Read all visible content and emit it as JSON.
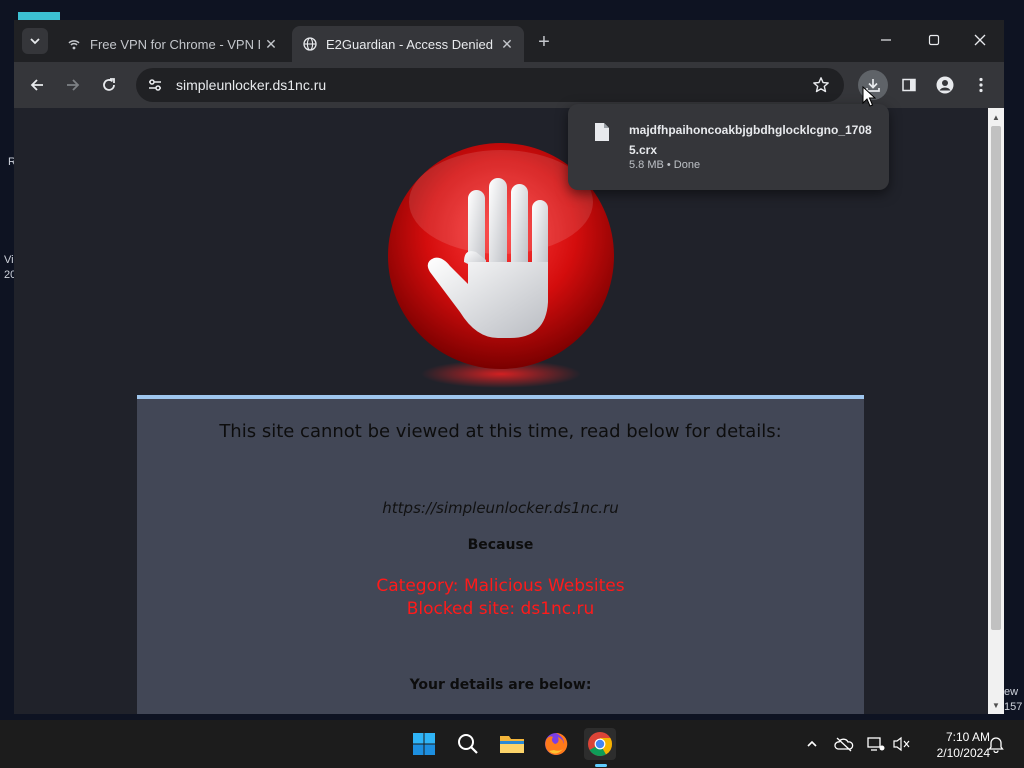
{
  "desktop": {
    "left_text_1": "R",
    "left_text_2": "Vi",
    "left_text_3": "20",
    "right_text_1": "ew",
    "right_text_2": "157"
  },
  "tabs": [
    {
      "title": "Free VPN for Chrome - VPN Pr",
      "icon": "vpn-icon",
      "active": false
    },
    {
      "title": "E2Guardian - Access Denied",
      "icon": "globe-icon",
      "active": true
    }
  ],
  "toolbar": {
    "url": "simpleunlocker.ds1nc.ru"
  },
  "download": {
    "filename": "majdfhpaihoncoakbjgbdhglocklcgno_17085.crx",
    "status": "5.8 MB • Done"
  },
  "page": {
    "heading": "This site cannot be viewed at this time, read below for details:",
    "blocked_url": "https://simpleunlocker.ds1nc.ru",
    "because": "Because",
    "category_line": "Category: Malicious Websites",
    "blocked_line": "Blocked site: ds1nc.ru",
    "details_heading": "Your details are below:"
  },
  "taskbar": {
    "time": "7:10 AM",
    "date": "2/10/2024"
  },
  "colors": {
    "accent": "#3cc0d2",
    "category_red": "#ff1a1a",
    "panel_bg": "#424756",
    "panel_border": "#9fc6ee"
  }
}
